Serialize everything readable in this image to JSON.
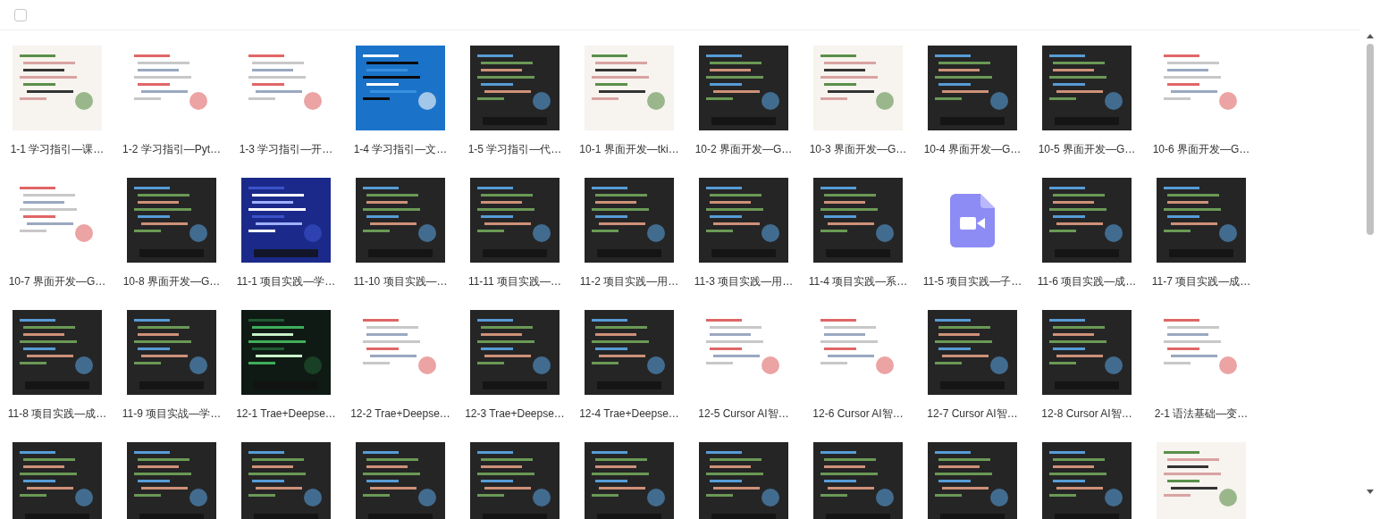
{
  "select_all": {
    "checked": false
  },
  "items": [
    {
      "kind": "picture",
      "caption": "1-1 学习指引—课…"
    },
    {
      "kind": "picture",
      "caption": "1-2 学习指引—Pyt…"
    },
    {
      "kind": "picture",
      "caption": "1-3 学习指引—开…"
    },
    {
      "kind": "picture",
      "caption": "1-4 学习指引—文…"
    },
    {
      "kind": "picture",
      "caption": "1-5 学习指引—代…"
    },
    {
      "kind": "picture",
      "caption": "10-1 界面开发—tki…"
    },
    {
      "kind": "picture",
      "caption": "10-2 界面开发—G…"
    },
    {
      "kind": "picture",
      "caption": "10-3 界面开发—G…"
    },
    {
      "kind": "picture",
      "caption": "10-4 界面开发—G…"
    },
    {
      "kind": "picture",
      "caption": "10-5 界面开发—G…"
    },
    {
      "kind": "picture",
      "caption": "10-6 界面开发—G…"
    },
    {
      "kind": "picture",
      "caption": "10-7 界面开发—G…"
    },
    {
      "kind": "picture",
      "caption": "10-8 界面开发—G…"
    },
    {
      "kind": "picture",
      "caption": "11-1 项目实践—学…"
    },
    {
      "kind": "picture",
      "caption": "11-10 项目实践—…"
    },
    {
      "kind": "picture",
      "caption": "11-11 项目实践—…"
    },
    {
      "kind": "picture",
      "caption": "11-2 项目实践—用…"
    },
    {
      "kind": "picture",
      "caption": "11-3 项目实践—用…"
    },
    {
      "kind": "picture",
      "caption": "11-4 项目实践—系…"
    },
    {
      "kind": "file",
      "caption": "11-5 项目实践—子…"
    },
    {
      "kind": "picture",
      "caption": "11-6 项目实践—成…"
    },
    {
      "kind": "picture",
      "caption": "11-7 项目实践—成…"
    },
    {
      "kind": "picture",
      "caption": "11-8 项目实践—成…"
    },
    {
      "kind": "picture",
      "caption": "11-9 项目实战—学…"
    },
    {
      "kind": "picture",
      "caption": "12-1 Trae+Deepse…"
    },
    {
      "kind": "picture",
      "caption": "12-2 Trae+Deepse…"
    },
    {
      "kind": "picture",
      "caption": "12-3 Trae+Deepse…"
    },
    {
      "kind": "picture",
      "caption": "12-4 Trae+Deepse…"
    },
    {
      "kind": "picture",
      "caption": "12-5 Cursor AI智…"
    },
    {
      "kind": "picture",
      "caption": "12-6 Cursor AI智…"
    },
    {
      "kind": "picture",
      "caption": "12-7 Cursor AI智…"
    },
    {
      "kind": "picture",
      "caption": "12-8 Cursor AI智…"
    },
    {
      "kind": "picture",
      "caption": "2-1 语法基础—变…"
    },
    {
      "kind": "picture"
    },
    {
      "kind": "picture"
    },
    {
      "kind": "picture"
    },
    {
      "kind": "picture"
    },
    {
      "kind": "picture"
    },
    {
      "kind": "picture"
    },
    {
      "kind": "picture"
    },
    {
      "kind": "picture"
    },
    {
      "kind": "picture"
    },
    {
      "kind": "picture"
    },
    {
      "kind": "picture"
    }
  ]
}
